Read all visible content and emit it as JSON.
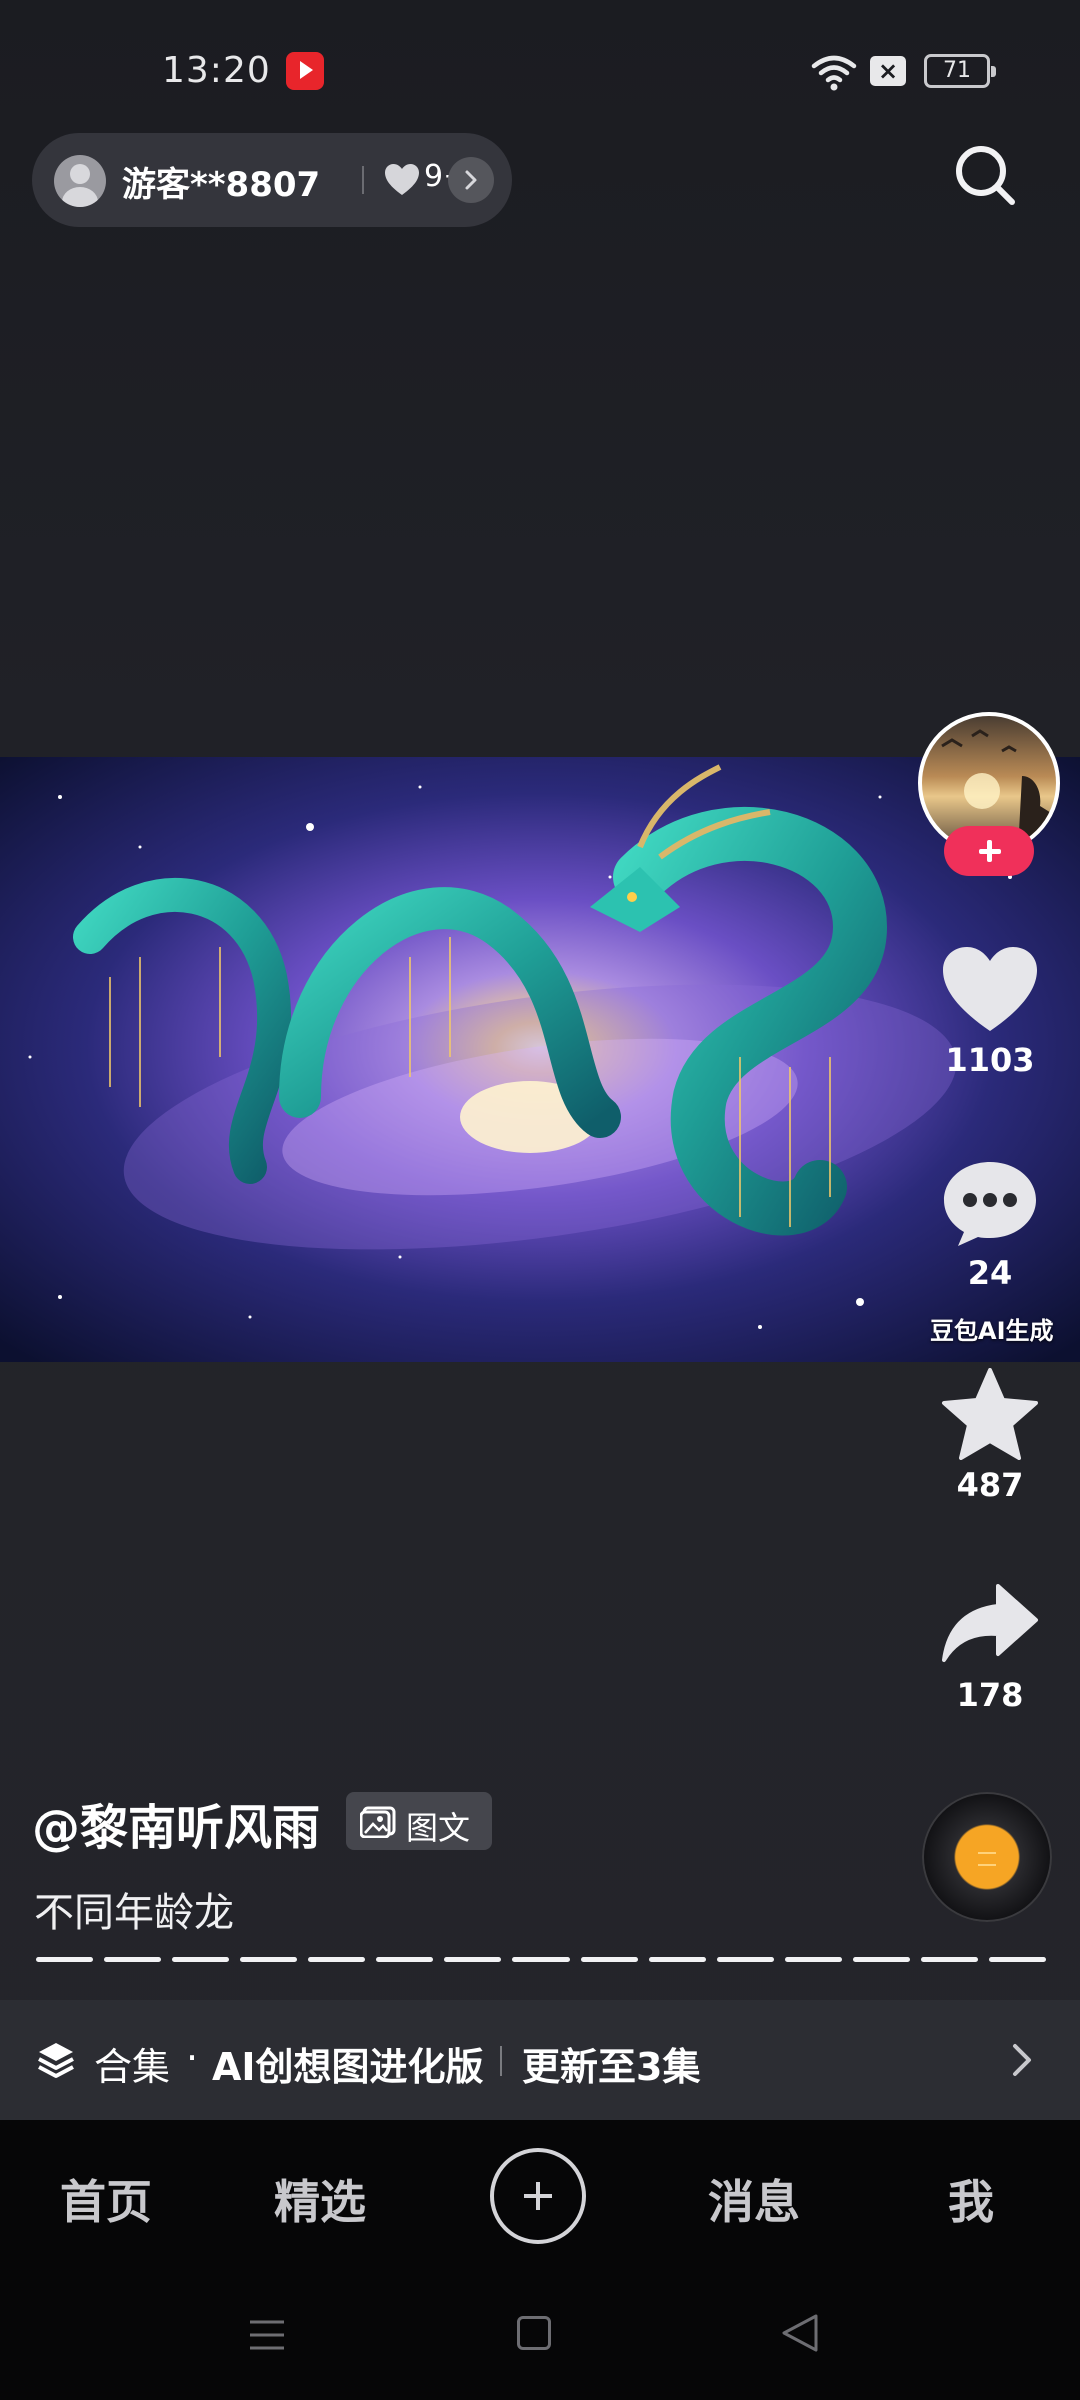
{
  "status_bar": {
    "time": "13:20",
    "battery": "71",
    "sim_icon": "x-mark-icon",
    "wifi_icon": "wifi-icon"
  },
  "header": {
    "user_name": "游客**8807",
    "likes_badge": "9+"
  },
  "post": {
    "ai_label": "豆包AI生成",
    "author": "@黎南听风雨",
    "type_tag": "图文",
    "caption": "不同年龄龙",
    "image_count": 15
  },
  "actions": {
    "likes": "1103",
    "comments": "24",
    "favorites": "487",
    "shares": "178"
  },
  "collection": {
    "label": "合集",
    "separator": "·",
    "name": "AI创想图进化版",
    "update": "更新至3集"
  },
  "nav": {
    "home": "首页",
    "featured": "精选",
    "messages": "消息",
    "me": "我"
  },
  "colors": {
    "accent_follow": "#f0305a",
    "background": "#1f2025"
  }
}
